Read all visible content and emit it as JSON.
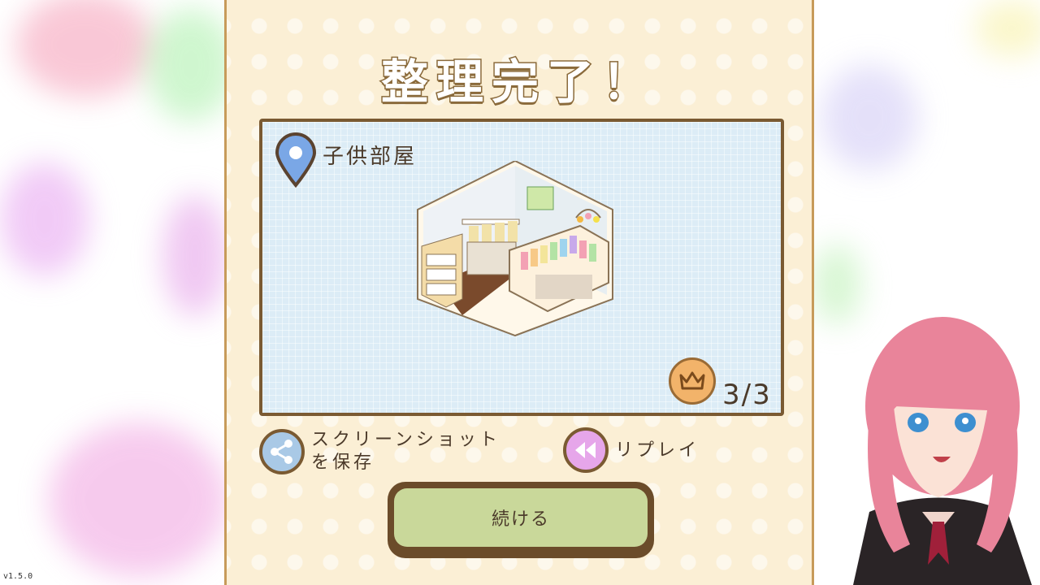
{
  "title": "整理完了！",
  "room": {
    "icon": "map-pin-icon",
    "name": "子供部屋"
  },
  "score": {
    "icon": "crown-icon",
    "value": "3/3"
  },
  "actions": {
    "screenshot_label_1": "スクリーンショット",
    "screenshot_label_2": "を保存",
    "replay_label": "リプレイ",
    "continue_label": "続ける"
  },
  "version": "v1.5.0",
  "colors": {
    "panel": "#fbefd5",
    "frame": "#7a5a32",
    "continue": "#c9d89a",
    "share": "#a9c9e6",
    "replay": "#e6a6ea",
    "crown": "#f2b36a"
  }
}
